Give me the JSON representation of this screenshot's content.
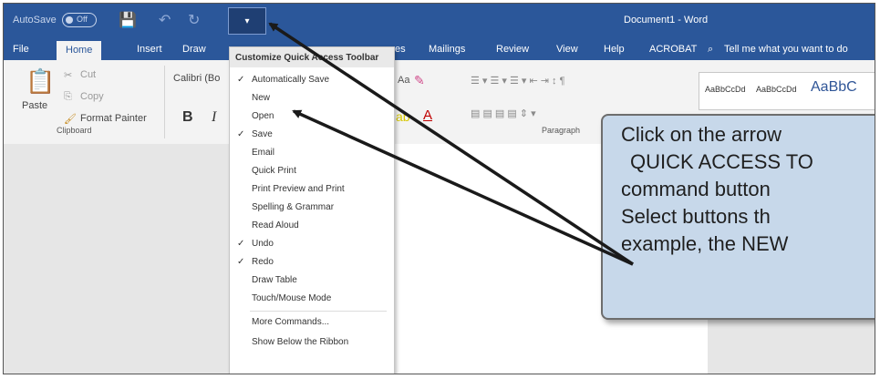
{
  "titlebar": {
    "autosave_label": "AutoSave",
    "autosave_state": "Off",
    "document_title": "Document1 - Word",
    "colors": {
      "brand": "#2b579a"
    }
  },
  "tabs": [
    "File",
    "Home",
    "Insert",
    "Draw",
    "es",
    "Mailings",
    "Review",
    "View",
    "Help",
    "ACROBAT"
  ],
  "tell_me": "Tell me what you want to do",
  "ribbon": {
    "paste": "Paste",
    "cut": "Cut",
    "copy": "Copy",
    "format_painter": "Format Painter",
    "clipboard": "Clipboard",
    "font_name": "Calibri (Bo",
    "bold": "B",
    "italic": "I",
    "paragraph": "Paragraph",
    "style1": "AaBbCcDd",
    "style2": "AaBbCcDd",
    "style3": "AaBbC"
  },
  "menu": {
    "header": "Customize Quick Access Toolbar",
    "items": [
      {
        "label": "Automatically Save",
        "checked": "✓"
      },
      {
        "label": "New",
        "checked": ""
      },
      {
        "label": "Open",
        "checked": ""
      },
      {
        "label": "Save",
        "checked": "✓"
      },
      {
        "label": "Email",
        "checked": ""
      },
      {
        "label": "Quick Print",
        "checked": ""
      },
      {
        "label": "Print Preview and Print",
        "checked": ""
      },
      {
        "label": "Spelling & Grammar",
        "checked": ""
      },
      {
        "label": "Read Aloud",
        "checked": ""
      },
      {
        "label": "Undo",
        "checked": "✓"
      },
      {
        "label": "Redo",
        "checked": "✓"
      },
      {
        "label": "Draw Table",
        "checked": ""
      },
      {
        "label": "Touch/Mouse Mode",
        "checked": ""
      },
      {
        "label": "More Commands...",
        "checked": ""
      },
      {
        "label": "Show Below the Ribbon",
        "checked": ""
      }
    ]
  },
  "callout": {
    "lines": [
      "Click on the arrow",
      "QUICK ACCESS TO",
      "command button",
      "Select buttons th",
      "example, the NEW"
    ]
  }
}
